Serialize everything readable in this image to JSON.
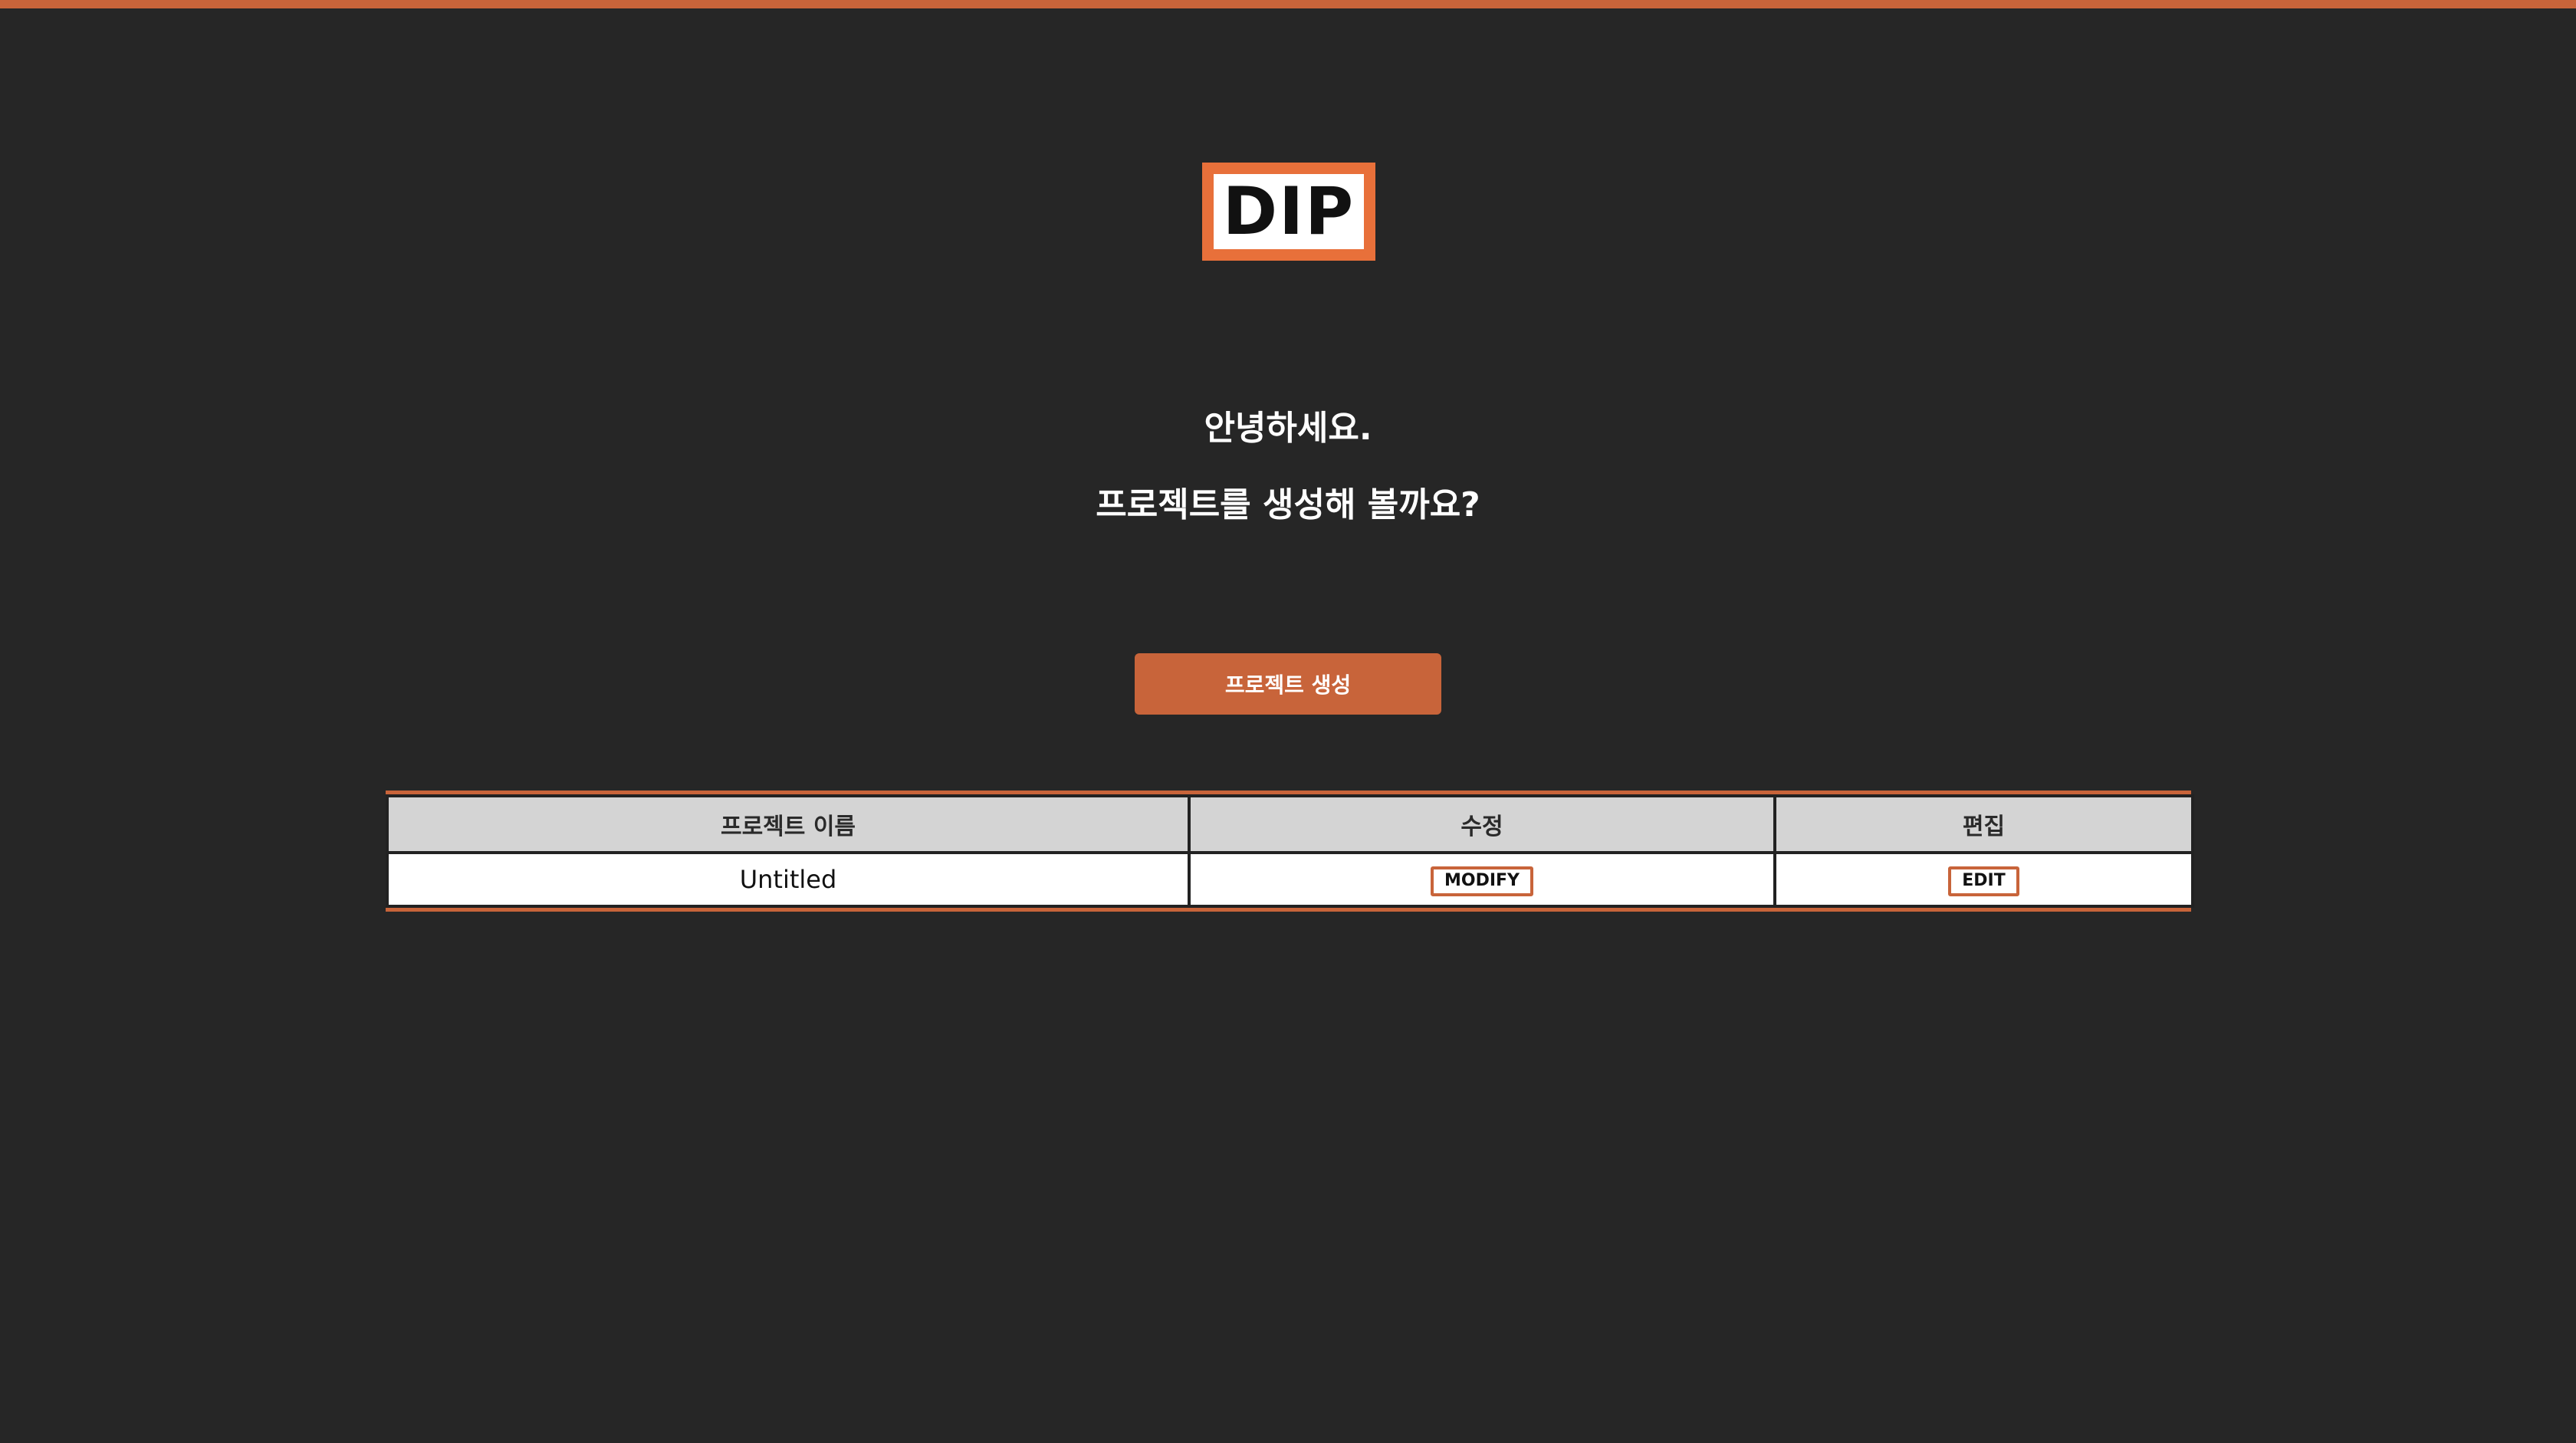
{
  "colors": {
    "background": "#262626",
    "accent": "#c8643a",
    "logo_border": "#e8703a",
    "header_row": "#d4d4d4"
  },
  "logo": {
    "text": "DIP"
  },
  "greeting": {
    "line1": "안녕하세요.",
    "line2": "프로젝트를 생성해 볼까요?"
  },
  "create_button": {
    "label": "프로젝트 생성"
  },
  "table": {
    "headers": [
      "프로젝트 이름",
      "수정",
      "편집"
    ],
    "rows": [
      {
        "name": "Untitled",
        "modify_label": "MODIFY",
        "edit_label": "EDIT"
      }
    ]
  }
}
